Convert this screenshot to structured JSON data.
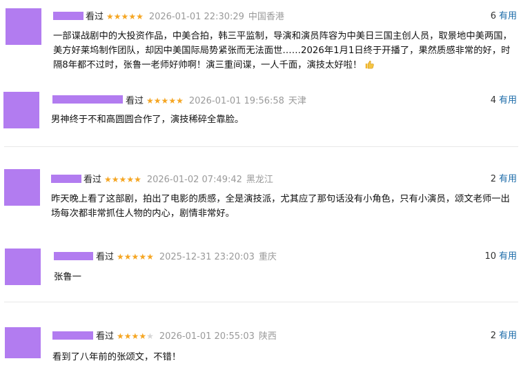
{
  "reviews": [
    {
      "watched": "看过",
      "rating": 5,
      "time": "2026-01-01 22:30:29",
      "location": "中国香港",
      "useful_count": "6",
      "useful_label": "有用",
      "content": "一部谍战剧中的大投资作品，中美合拍，韩三平监制，导演和演员阵容为中美日三国主创人员，取景地中美两国，美方好莱坞制作团队，却因中美国际局势紧张而无法面世……2026年1月1日终于开播了，果然质感非常的好，时隔8年都不过时，张鲁一老师好帅啊！演三重间谍，一人千面，演技太好啦！",
      "emoji": "thumbs-up-icon"
    },
    {
      "watched": "看过",
      "rating": 5,
      "time": "2026-01-01 19:56:58",
      "location": "天津",
      "useful_count": "4",
      "useful_label": "有用",
      "content": "男神终于不和高圆圆合作了，演技稀碎全靠脸。"
    },
    {
      "watched": "看过",
      "rating": 5,
      "time": "2026-01-02 07:49:42",
      "location": "黑龙江",
      "useful_count": "2",
      "useful_label": "有用",
      "content": "昨天晚上看了这部剧，拍出了电影的质感，全是演技派，尤其应了那句话没有小角色，只有小演员，颂文老师一出场每次都非常抓住人物的内心，剧情非常好。"
    },
    {
      "watched": "看过",
      "rating": 5,
      "time": "2025-12-31 23:20:03",
      "location": "重庆",
      "useful_count": "10",
      "useful_label": "有用",
      "content": "张鲁一"
    },
    {
      "watched": "看过",
      "rating": 4,
      "time": "2026-01-01 20:55:03",
      "location": "陕西",
      "useful_count": "2",
      "useful_label": "有用",
      "content": "看到了八年前的张颂文，不错！"
    }
  ],
  "colors": {
    "avatar_placeholder": "#b27cf0",
    "star_on": "#f5a623",
    "star_off": "#d6d6d6",
    "link": "#1a6aa8",
    "meta_gray": "#9a9a9a"
  }
}
